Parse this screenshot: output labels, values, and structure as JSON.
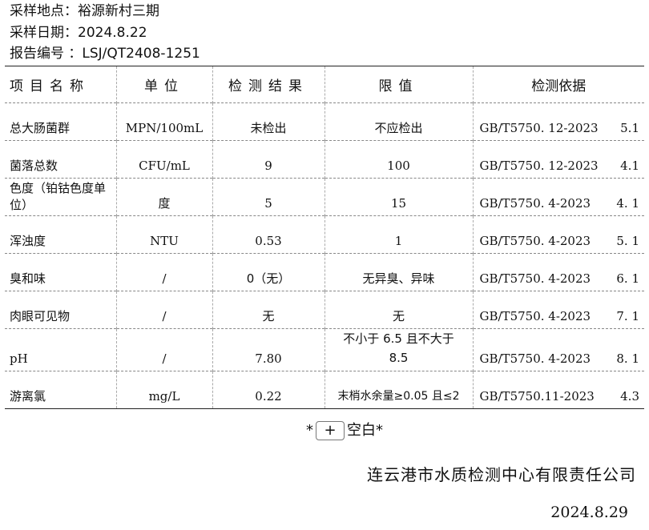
{
  "info": {
    "location": "采样地点：裕源新村三期",
    "date": "采样日期：2024.8.22",
    "report_no": "报告编号 ：LSJ/QT2408-1251"
  },
  "table": {
    "headers": {
      "item": "项目名称",
      "unit": "单位",
      "result": "检测结果",
      "limit": "限值",
      "method": "检测依据"
    },
    "rows": [
      {
        "item": "总大肠菌群",
        "unit": "MPN/100mL",
        "result": "未检出",
        "limit": "不应检出",
        "method": "GB/T5750. 12-2023",
        "clause": "5.1"
      },
      {
        "item": "菌落总数",
        "unit": "CFU/mL",
        "result": "9",
        "limit": "100",
        "method": "GB/T5750. 12-2023",
        "clause": "4.1"
      },
      {
        "item": "色度（铂钴色度单位）",
        "unit": "度",
        "result": "5",
        "limit": "15",
        "method": "GB/T5750. 4-2023",
        "clause": "4. 1"
      },
      {
        "item": "浑浊度",
        "unit": "NTU",
        "result": "0.53",
        "limit": "1",
        "method": "GB/T5750. 4-2023",
        "clause": "5. 1"
      },
      {
        "item": "臭和味",
        "unit": "/",
        "result": "0（无）",
        "limit": "无异臭、异味",
        "method": "GB/T5750. 4-2023",
        "clause": "6. 1"
      },
      {
        "item": "肉眼可见物",
        "unit": "/",
        "result": "无",
        "limit": "无",
        "method": "GB/T5750. 4-2023",
        "clause": "7. 1"
      },
      {
        "item": "pH",
        "unit": "/",
        "result": "7.80",
        "limit": "不小于 6.5 且不大于 8.5",
        "method": "GB/T5750. 4-2023",
        "clause": "8. 1"
      },
      {
        "item": "游离氯",
        "unit": "mg/L",
        "result": "0.22",
        "limit": "末梢水余量≥0.05 且≤2",
        "method": "GB/T5750.11-2023",
        "clause": "4.3"
      }
    ]
  },
  "footer": {
    "blank_prefix": "*",
    "blank_plus": "+",
    "blank_suffix": "空白*",
    "company": "连云港市水质检测中心有限责任公司",
    "date": "2024.8.29"
  }
}
